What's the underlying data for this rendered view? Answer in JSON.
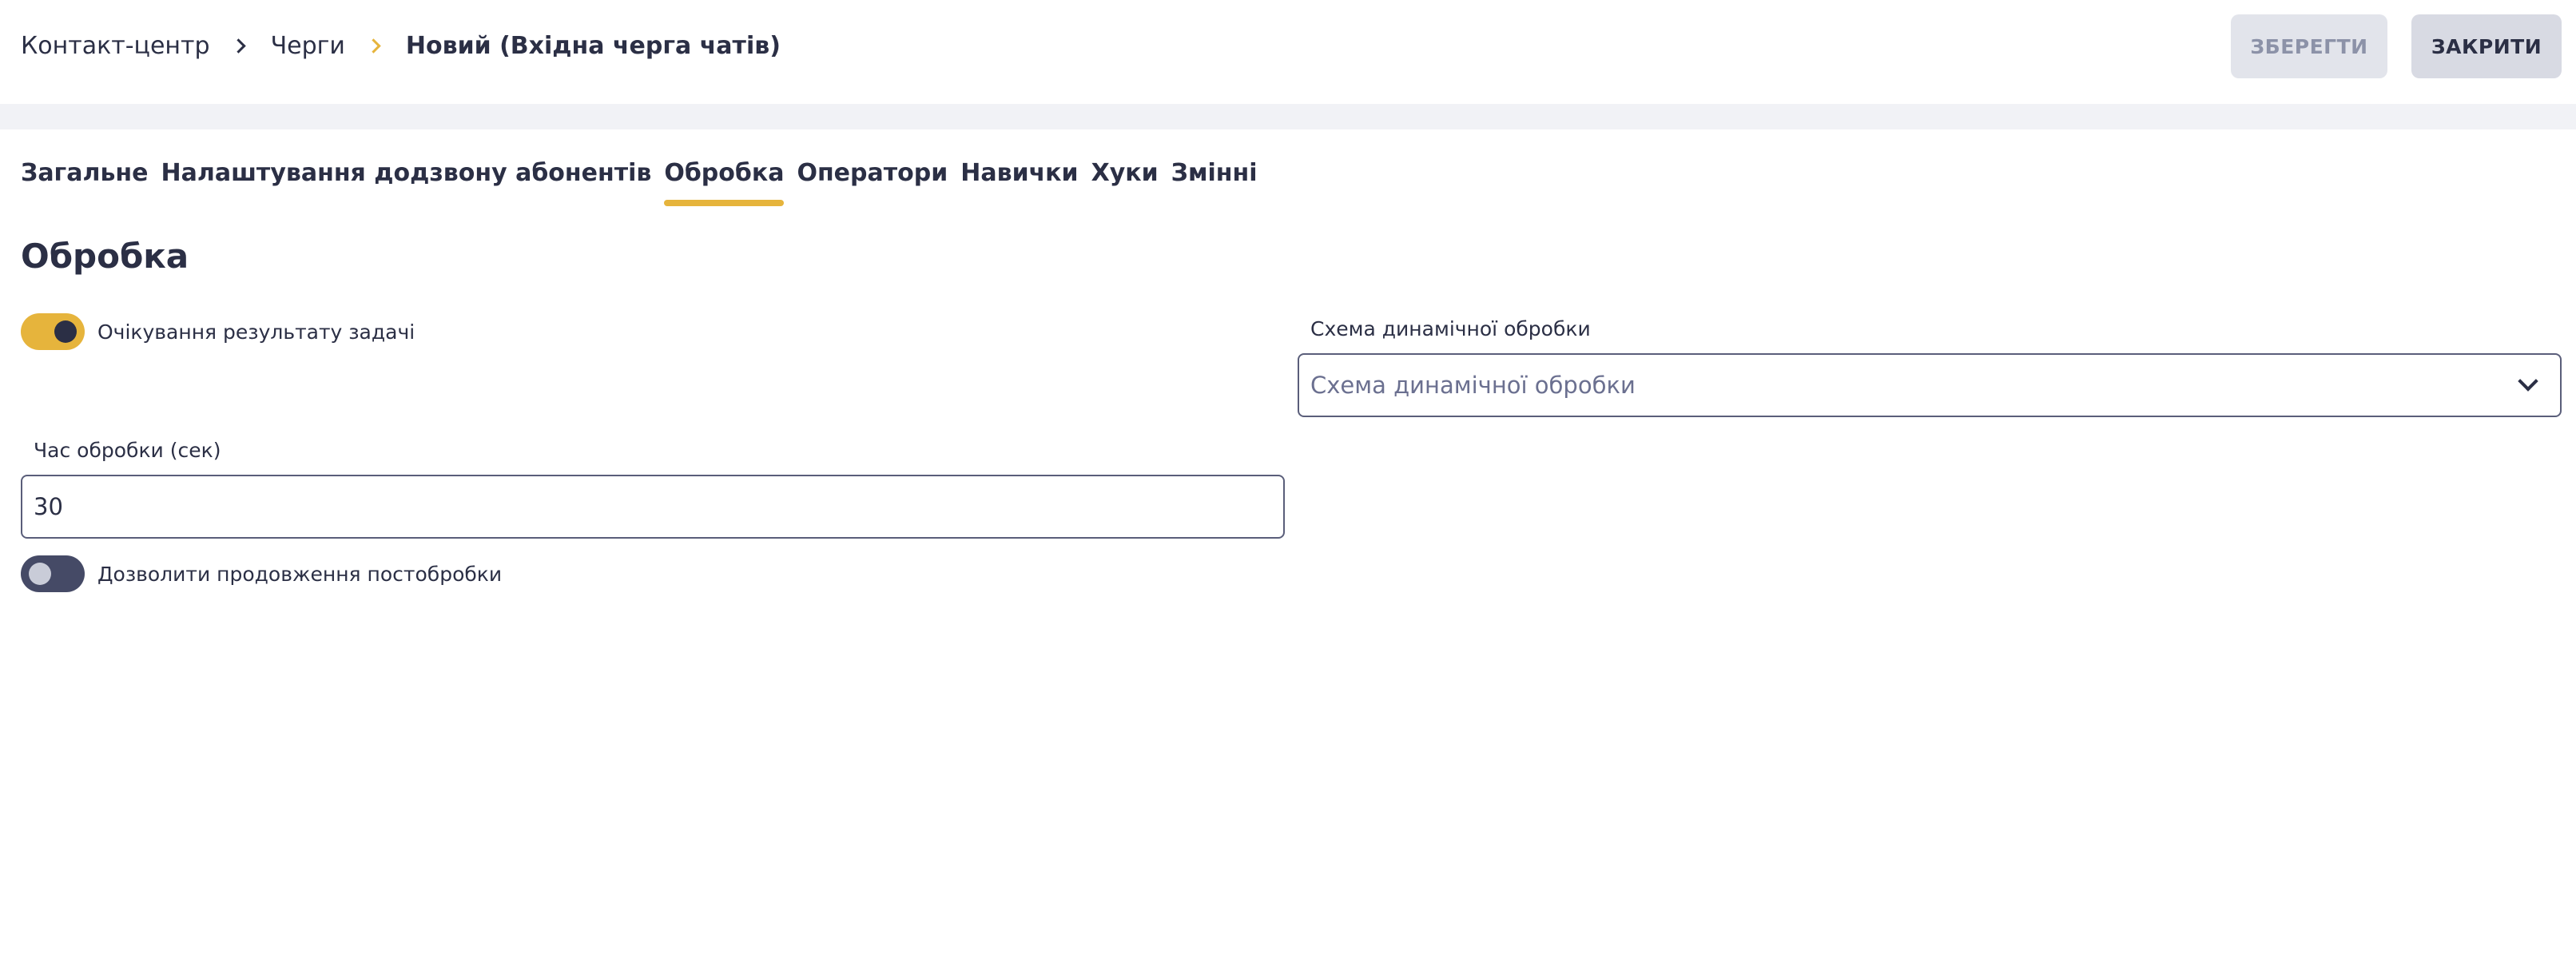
{
  "breadcrumb": {
    "items": [
      "Контакт-центр",
      "Черги"
    ],
    "current": "Новий (Вхідна черга чатів)"
  },
  "actions": {
    "save_label": "ЗБЕРЕГТИ",
    "close_label": "ЗАКРИТИ"
  },
  "tabs": [
    {
      "label": "Загальне",
      "active": false
    },
    {
      "label": "Налаштування додзвону абонентів",
      "active": false
    },
    {
      "label": "Обробка",
      "active": true
    },
    {
      "label": "Оператори",
      "active": false
    },
    {
      "label": "Навички",
      "active": false
    },
    {
      "label": "Хуки",
      "active": false
    },
    {
      "label": "Змінні",
      "active": false
    }
  ],
  "section": {
    "title": "Обробка",
    "wait_result_toggle": {
      "label": "Очікування результату задачі",
      "on": true
    },
    "dynamic_scheme": {
      "label": "Схема динамічної обробки",
      "placeholder": "Схема динамічної обробки"
    },
    "processing_time": {
      "label": "Час обробки (сек)",
      "value": "30"
    },
    "allow_extension_toggle": {
      "label": "Дозволити продовження постобробки",
      "on": false
    }
  },
  "colors": {
    "accent": "#e6b43c",
    "text": "#2b2f45",
    "toggle_off": "#454a66",
    "band": "#f1f2f6"
  }
}
